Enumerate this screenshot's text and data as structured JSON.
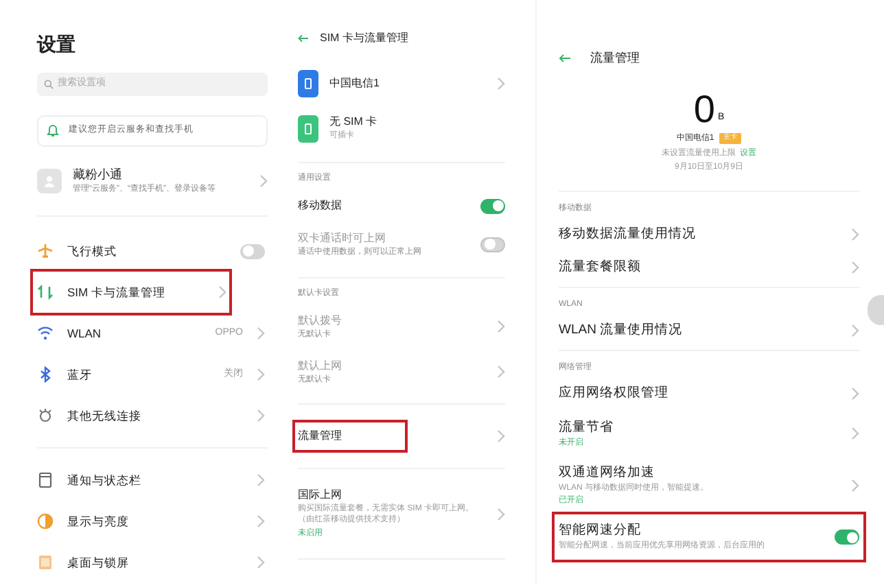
{
  "settings": {
    "title": "设置",
    "search": {
      "placeholder": "搜索设置项"
    },
    "banner": "建议您开启云服务和查找手机",
    "account": {
      "name": "藏粉小通",
      "subtitle": "管理“云服务”、“查找手机”、登录设备等"
    },
    "groups": [
      [
        {
          "label": "飞行模式",
          "kind": "toggle",
          "on": false,
          "highlighted": false
        },
        {
          "label": "SIM 卡与流量管理",
          "kind": "link",
          "highlighted": true
        },
        {
          "label": "WLAN",
          "value": "OPPO",
          "kind": "link",
          "highlighted": false
        },
        {
          "label": "蓝牙",
          "value": "关闭",
          "kind": "link",
          "highlighted": false
        },
        {
          "label": "其他无线连接",
          "kind": "link",
          "highlighted": false
        }
      ],
      [
        {
          "label": "通知与状态栏",
          "kind": "link",
          "highlighted": false
        },
        {
          "label": "显示与亮度",
          "kind": "link",
          "highlighted": false
        },
        {
          "label": "桌面与锁屏",
          "kind": "link",
          "highlighted": false
        }
      ]
    ]
  },
  "sim_page": {
    "title": "SIM 卡与流量管理",
    "cards": [
      {
        "name": "中国电信1",
        "color": "#2f7be5"
      },
      {
        "name": "无 SIM 卡",
        "subtitle": "可插卡",
        "color": "#3cc47c"
      }
    ],
    "sections": [
      {
        "header": "通用设置",
        "rows": [
          {
            "label": "移动数据",
            "kind": "toggle",
            "on": true,
            "disabled": false
          },
          {
            "label": "双卡通话时可上网",
            "subtitle": "通话中使用数据，则可以正常上网",
            "kind": "toggle",
            "on": false,
            "disabled": true
          }
        ]
      },
      {
        "header": "默认卡设置",
        "rows": [
          {
            "label": "默认拨号",
            "subtitle": "无默认卡",
            "kind": "link",
            "disabled": true
          },
          {
            "label": "默认上网",
            "subtitle": "无默认卡",
            "kind": "link",
            "disabled": true
          }
        ]
      },
      {
        "rows": [
          {
            "label": "流量管理",
            "kind": "link",
            "disabled": false,
            "highlighted": true
          }
        ]
      },
      {
        "rows": [
          {
            "label": "国际上网",
            "subtitle": "购买国际流量套餐，无需实体 SIM 卡即可上网。（由红茶移动提供技术支持）",
            "status": "未启用",
            "kind": "link",
            "disabled": false
          }
        ]
      }
    ]
  },
  "data_page": {
    "title": "流量管理",
    "usage": "0",
    "unit": "B",
    "carrier": "中国电信1",
    "badge": "主卡",
    "limit_note": "未设置流量使用上限",
    "limit_link": "设置",
    "period": "9月10日至10月9日",
    "sections": [
      {
        "header": "移动数据",
        "rows": [
          {
            "label": "移动数据流量使用情况",
            "kind": "link"
          },
          {
            "label": "流量套餐限额",
            "kind": "link"
          }
        ]
      },
      {
        "header": "WLAN",
        "rows": [
          {
            "label": "WLAN 流量使用情况",
            "kind": "link"
          }
        ]
      },
      {
        "header": "网络管理",
        "rows": [
          {
            "label": "应用网络权限管理",
            "kind": "link"
          },
          {
            "label": "流量节省",
            "status": "未开启",
            "kind": "link"
          },
          {
            "label": "双通道网络加速",
            "subtitle": "WLAN 与移动数据同时使用，智能提速。",
            "status": "已开启",
            "kind": "link"
          },
          {
            "label": "智能网速分配",
            "subtitle": "智能分配网速，当前应用优先享用网络资源，后台应用的",
            "kind": "toggle",
            "on": true,
            "highlighted": true
          }
        ]
      }
    ]
  }
}
